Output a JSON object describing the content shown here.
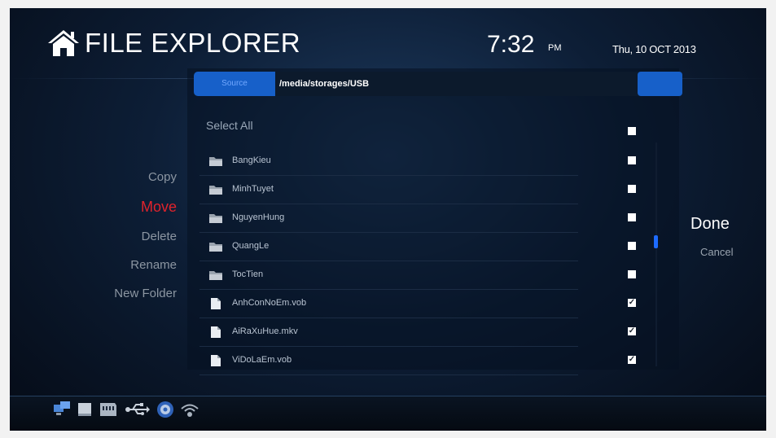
{
  "header": {
    "title": "FILE EXPLORER",
    "time": "7:32",
    "ampm": "PM",
    "date": "Thu, 10 OCT 2013"
  },
  "source": {
    "label": "Source",
    "path": "/media/storages/USB"
  },
  "select_all_label": "Select All",
  "menu": {
    "copy": "Copy",
    "move": "Move",
    "delete": "Delete",
    "rename": "Rename",
    "new_folder": "New Folder"
  },
  "actions": {
    "done": "Done",
    "cancel": "Cancel"
  },
  "files": [
    {
      "name": "BangKieu",
      "type": "folder",
      "checked": false
    },
    {
      "name": "MinhTuyet",
      "type": "folder",
      "checked": false
    },
    {
      "name": "NguyenHung",
      "type": "folder",
      "checked": false
    },
    {
      "name": "QuangLe",
      "type": "folder",
      "checked": false
    },
    {
      "name": "TocTien",
      "type": "folder",
      "checked": false
    },
    {
      "name": "AnhConNoEm.vob",
      "type": "file",
      "checked": true
    },
    {
      "name": "AiRaXuHue.mkv",
      "type": "file",
      "checked": true
    },
    {
      "name": "ViDoLaEm.vob",
      "type": "file",
      "checked": true
    }
  ],
  "status_icons": [
    "network-icon",
    "storage-icon",
    "card-reader-icon",
    "usb-icon",
    "3d-icon",
    "wifi-icon"
  ],
  "colors": {
    "accent_blue": "#1760c9",
    "active_menu_red": "#e0232c",
    "scroll_thumb": "#1d6bff"
  }
}
